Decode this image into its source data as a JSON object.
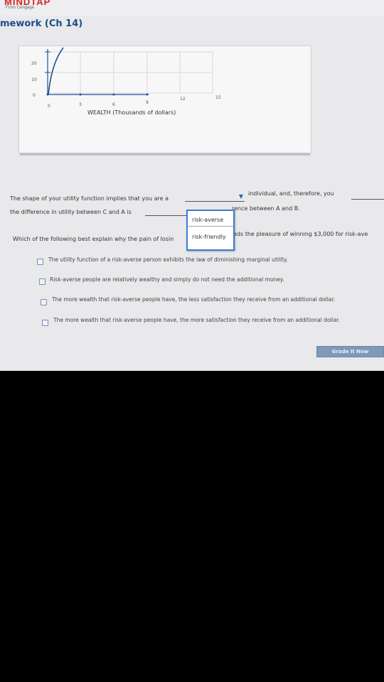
{
  "header": {
    "brand": "MINDTAP",
    "brand_sub": "From Cengage",
    "page_title": "mework (Ch 14)"
  },
  "graph": {
    "y_ticks": [
      "20",
      "10",
      "0"
    ],
    "x_ticks": [
      "0",
      "3",
      "6",
      "9",
      "12",
      "15"
    ],
    "x_label": "WEALTH (Thousands of dollars)"
  },
  "question1": {
    "part1": "The shape of your utility function implies that you are a",
    "part2": "individual, and, therefore, you",
    "part3": "the difference in utility between C and A is",
    "part4": "rence between A and B."
  },
  "dropdown": {
    "selected": "",
    "options": [
      "risk-averse",
      "risk-friendly"
    ]
  },
  "question2": {
    "prompt_left": "Which of the following best explain why the pain of losin",
    "prompt_right": "eds the pleasure of winning $3,000 for risk-ave"
  },
  "choices": [
    "The utility function of a risk-averse person exhibits the law of diminishing marginal utility.",
    "Risk-averse people are relatively wealthy and simply do not need the additional money.",
    "The more wealth that risk-averse people have, the less satisfaction they receive from an additional dollar.",
    "The more wealth that risk-averse people have, the more satisfaction they receive from an additional dollar."
  ],
  "buttons": {
    "grade": "Grade It Now"
  }
}
